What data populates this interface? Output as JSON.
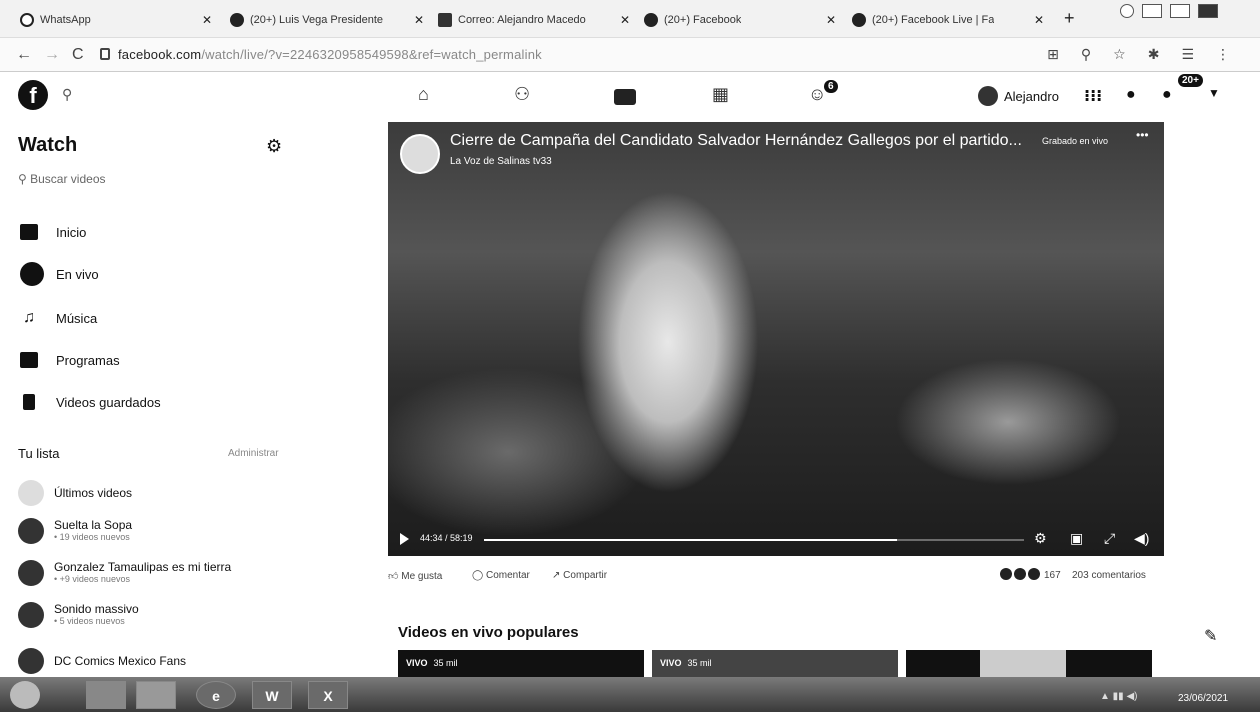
{
  "browser": {
    "tabs": [
      {
        "label": "WhatsApp",
        "icon": "whatsapp-icon"
      },
      {
        "label": "(20+) Luis Vega Presidente",
        "icon": "facebook-icon"
      },
      {
        "label": "Correo: Alejandro Macedo",
        "icon": "mail-icon"
      },
      {
        "label": "(20+) Facebook",
        "icon": "facebook-icon"
      },
      {
        "label": "(20+) Facebook Live | Fa",
        "icon": "facebook-icon"
      }
    ],
    "new_tab": "+",
    "url_host": "facebook.com",
    "url_rest": "/watch/live/?v=2246320958549598&ref=watch_permalink"
  },
  "fb_nav": {
    "search_icon": "search-icon",
    "notif_groups_count": "6",
    "profile_name": "Alejandro",
    "notif_count": "20+"
  },
  "sidebar": {
    "title": "Watch",
    "search_placeholder": "Buscar videos",
    "menu": [
      {
        "label": "Inicio",
        "icon": "home-icon"
      },
      {
        "label": "En vivo",
        "icon": "live-icon"
      },
      {
        "label": "Música",
        "icon": "music-icon"
      },
      {
        "label": "Programas",
        "icon": "shows-icon"
      },
      {
        "label": "Videos guardados",
        "icon": "bookmark-icon"
      }
    ],
    "your_list_title": "Tu lista",
    "manage_label": "Administrar",
    "list": [
      {
        "name": "Últimos videos",
        "sub": ""
      },
      {
        "name": "Suelta la Sopa",
        "sub": "• 19 videos nuevos"
      },
      {
        "name": "Gonzalez Tamaulipas es mi tierra",
        "sub": "• +9 videos nuevos"
      },
      {
        "name": "Sonido massivo",
        "sub": "• 5 videos nuevos"
      },
      {
        "name": "DC Comics Mexico Fans",
        "sub": ""
      }
    ]
  },
  "video": {
    "title": "Cierre de Campaña del Candidato Salvador Hernández Gallegos por el partido...",
    "channel": "La Voz de Salinas tv33",
    "live_status": "Grabado en vivo",
    "more": "•••",
    "time": "44:34 / 58:19",
    "progress": 0.765
  },
  "actions": {
    "like": "Me gusta",
    "comment": "Comentar",
    "share": "Compartir",
    "reaction_count": "167",
    "comment_count": "203 comentarios"
  },
  "popular": {
    "title": "Videos en vivo populares",
    "thumbs": [
      {
        "badge": "VIVO",
        "views": "35 mil"
      },
      {
        "badge": "VIVO",
        "views": "35 mil"
      },
      {
        "badge": "",
        "views": ""
      }
    ]
  },
  "taskbar": {
    "apps": [
      "e",
      "W",
      "X"
    ],
    "date": "23/06/2021"
  }
}
